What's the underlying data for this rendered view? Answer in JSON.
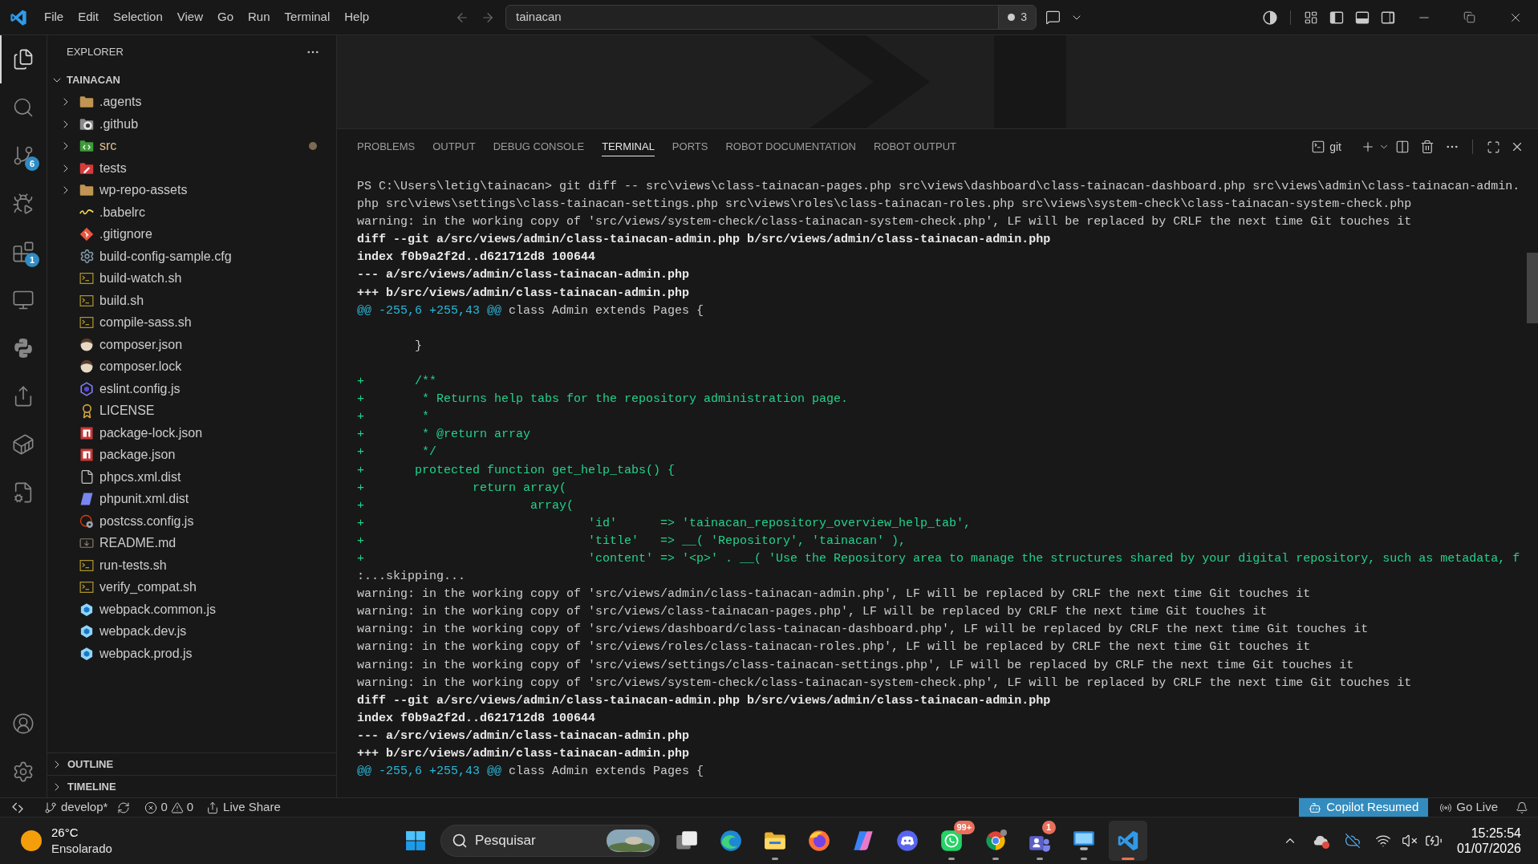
{
  "title_bar": {
    "menu": [
      "File",
      "Edit",
      "Selection",
      "View",
      "Go",
      "Run",
      "Terminal",
      "Help"
    ],
    "search": {
      "label": "tainacan",
      "badge": "3"
    },
    "layout_toggles": [
      {
        "kind": "primary-sidebar",
        "on": true
      },
      {
        "kind": "panel",
        "on": true
      },
      {
        "kind": "secondary-sidebar",
        "on": false
      }
    ]
  },
  "activity_bar": {
    "items": [
      {
        "kind": "explorer",
        "selected": true
      },
      {
        "kind": "search",
        "selected": false
      },
      {
        "kind": "source-control",
        "selected": false,
        "badge": "6"
      },
      {
        "kind": "run-debug",
        "selected": false
      },
      {
        "kind": "extensions",
        "selected": false,
        "badge": "1"
      },
      {
        "kind": "remote-explorer",
        "selected": false
      },
      {
        "kind": "python",
        "selected": false
      },
      {
        "kind": "live-share",
        "selected": false
      },
      {
        "kind": "containers",
        "selected": false
      },
      {
        "kind": "file-tools",
        "selected": false
      }
    ],
    "bottom": [
      {
        "kind": "accounts"
      },
      {
        "kind": "settings"
      }
    ]
  },
  "explorer": {
    "title": "EXPLORER",
    "root": {
      "label": "TAINACAN",
      "expanded": true,
      "children": [
        {
          "label": ".agents",
          "kind": "folder",
          "expanded": false,
          "modified": false
        },
        {
          "label": ".github",
          "kind": "github-folder",
          "expanded": false,
          "modified": false
        },
        {
          "label": "src",
          "kind": "source-folder",
          "expanded": false,
          "modified": true
        },
        {
          "label": "tests",
          "kind": "test-folder",
          "expanded": false,
          "modified": false
        },
        {
          "label": "wp-repo-assets",
          "kind": "folder",
          "expanded": false,
          "modified": false
        },
        {
          "label": ".babelrc",
          "kind": "babel",
          "modified": false
        },
        {
          "label": ".gitignore",
          "kind": "git",
          "modified": false
        },
        {
          "label": "build-config-sample.cfg",
          "kind": "config",
          "modified": false
        },
        {
          "label": "build-watch.sh",
          "kind": "shell",
          "modified": false
        },
        {
          "label": "build.sh",
          "kind": "shell",
          "modified": false
        },
        {
          "label": "compile-sass.sh",
          "kind": "shell",
          "modified": false
        },
        {
          "label": "composer.json",
          "kind": "composer",
          "modified": false
        },
        {
          "label": "composer.lock",
          "kind": "composer",
          "modified": false
        },
        {
          "label": "eslint.config.js",
          "kind": "eslint",
          "modified": false
        },
        {
          "label": "LICENSE",
          "kind": "license",
          "modified": false
        },
        {
          "label": "package-lock.json",
          "kind": "npm",
          "modified": false
        },
        {
          "label": "package.json",
          "kind": "npm",
          "modified": false
        },
        {
          "label": "phpcs.xml.dist",
          "kind": "text",
          "modified": false
        },
        {
          "label": "phpunit.xml.dist",
          "kind": "phpunit",
          "modified": false
        },
        {
          "label": "postcss.config.js",
          "kind": "postcss",
          "modified": false
        },
        {
          "label": "README.md",
          "kind": "markdown",
          "modified": false
        },
        {
          "label": "run-tests.sh",
          "kind": "shell",
          "modified": false
        },
        {
          "label": "verify_compat.sh",
          "kind": "shell",
          "modified": false
        },
        {
          "label": "webpack.common.js",
          "kind": "webpack",
          "modified": false
        },
        {
          "label": "webpack.dev.js",
          "kind": "webpack",
          "modified": false
        },
        {
          "label": "webpack.prod.js",
          "kind": "webpack",
          "modified": false
        }
      ]
    },
    "sections": [
      {
        "label": "OUTLINE",
        "expanded": false
      },
      {
        "label": "TIMELINE",
        "expanded": false
      }
    ]
  },
  "panel": {
    "tabs": [
      {
        "label": "PROBLEMS",
        "selected": false
      },
      {
        "label": "OUTPUT",
        "selected": false
      },
      {
        "label": "DEBUG CONSOLE",
        "selected": false
      },
      {
        "label": "TERMINAL",
        "selected": true
      },
      {
        "label": "PORTS",
        "selected": false
      },
      {
        "label": "ROBOT DOCUMENTATION",
        "selected": false
      },
      {
        "label": "ROBOT OUTPUT",
        "selected": false
      }
    ],
    "terminal": {
      "shell": "git",
      "lines": [
        {
          "kind": "prompt",
          "prompt": "PS C:\\Users\\letig\\tainacan>",
          "text": "git diff -- src\\views\\class-tainacan-pages.php src\\views\\dashboard\\class-tainacan-dashboard.php src\\views\\admin\\class-tainacan-admin."
        },
        {
          "kind": "plain",
          "text": "php src\\views\\settings\\class-tainacan-settings.php src\\views\\roles\\class-tainacan-roles.php src\\views\\system-check\\class-tainacan-system-check.php"
        },
        {
          "kind": "plain",
          "text": "warning: in the working copy of 'src/views/system-check/class-tainacan-system-check.php', LF will be replaced by CRLF the next time Git touches it"
        },
        {
          "kind": "bold",
          "text": "diff --git a/src/views/admin/class-tainacan-admin.php b/src/views/admin/class-tainacan-admin.php"
        },
        {
          "kind": "bold",
          "text": "index f0b9a2f2d..d621712d8 100644"
        },
        {
          "kind": "bold",
          "text": "--- a/src/views/admin/class-tainacan-admin.php"
        },
        {
          "kind": "bold",
          "text": "+++ b/src/views/admin/class-tainacan-admin.php"
        },
        {
          "kind": "hunk",
          "marker": "@@ -255,6 +255,43 @@",
          "text": "class Admin extends Pages {"
        },
        {
          "kind": "blank"
        },
        {
          "kind": "plain",
          "text": "        }"
        },
        {
          "kind": "blank"
        },
        {
          "kind": "added",
          "text": "+       /**"
        },
        {
          "kind": "added",
          "text": "+        * Returns help tabs for the repository administration page."
        },
        {
          "kind": "added",
          "text": "+        *"
        },
        {
          "kind": "added",
          "text": "+        * @return array"
        },
        {
          "kind": "added",
          "text": "+        */"
        },
        {
          "kind": "added",
          "text": "+       protected function get_help_tabs() {"
        },
        {
          "kind": "added",
          "text": "+               return array("
        },
        {
          "kind": "added",
          "text": "+                       array("
        },
        {
          "kind": "added",
          "text": "+                               'id'      => 'tainacan_repository_overview_help_tab',"
        },
        {
          "kind": "added",
          "text": "+                               'title'   => __( 'Repository', 'tainacan' ),"
        },
        {
          "kind": "added",
          "text": "+                               'content' => '<p>' . __( 'Use the Repository area to manage the structures shared by your digital repository, such as metadata, f"
        },
        {
          "kind": "plain",
          "text": ":...skipping..."
        },
        {
          "kind": "plain",
          "text": "warning: in the working copy of 'src/views/admin/class-tainacan-admin.php', LF will be replaced by CRLF the next time Git touches it"
        },
        {
          "kind": "plain",
          "text": "warning: in the working copy of 'src/views/class-tainacan-pages.php', LF will be replaced by CRLF the next time Git touches it"
        },
        {
          "kind": "plain",
          "text": "warning: in the working copy of 'src/views/dashboard/class-tainacan-dashboard.php', LF will be replaced by CRLF the next time Git touches it"
        },
        {
          "kind": "plain",
          "text": "warning: in the working copy of 'src/views/roles/class-tainacan-roles.php', LF will be replaced by CRLF the next time Git touches it"
        },
        {
          "kind": "plain",
          "text": "warning: in the working copy of 'src/views/settings/class-tainacan-settings.php', LF will be replaced by CRLF the next time Git touches it"
        },
        {
          "kind": "plain",
          "text": "warning: in the working copy of 'src/views/system-check/class-tainacan-system-check.php', LF will be replaced by CRLF the next time Git touches it"
        },
        {
          "kind": "bold",
          "text": "diff --git a/src/views/admin/class-tainacan-admin.php b/src/views/admin/class-tainacan-admin.php"
        },
        {
          "kind": "bold",
          "text": "index f0b9a2f2d..d621712d8 100644"
        },
        {
          "kind": "bold",
          "text": "--- a/src/views/admin/class-tainacan-admin.php"
        },
        {
          "kind": "bold",
          "text": "+++ b/src/views/admin/class-tainacan-admin.php"
        },
        {
          "kind": "hunk",
          "marker": "@@ -255,6 +255,43 @@",
          "text": "class Admin extends Pages {"
        }
      ]
    }
  },
  "status_bar": {
    "branch": "develop*",
    "errors": "0",
    "warnings": "0",
    "live_share": "Live Share",
    "copilot": "Copilot Resumed",
    "go_live": "Go Live"
  },
  "taskbar": {
    "weather": {
      "temperature": "26°C",
      "condition": "Ensolarado"
    },
    "search": {
      "placeholder": "Pesquisar"
    },
    "apps": [
      {
        "kind": "task-view",
        "running": false,
        "selected": false
      },
      {
        "kind": "edge",
        "running": false,
        "selected": false
      },
      {
        "kind": "file-explorer",
        "running": true,
        "selected": false
      },
      {
        "kind": "firefox",
        "running": false,
        "selected": false
      },
      {
        "kind": "copilot",
        "running": false,
        "selected": false
      },
      {
        "kind": "discord",
        "running": false,
        "selected": false
      },
      {
        "kind": "whatsapp",
        "running": true,
        "selected": false,
        "badge": "99+"
      },
      {
        "kind": "chrome",
        "running": true,
        "selected": false
      },
      {
        "kind": "teams",
        "running": true,
        "selected": false,
        "badge": "1"
      },
      {
        "kind": "remote-desktop",
        "running": true,
        "selected": false
      },
      {
        "kind": "vscode",
        "running": true,
        "selected": true
      }
    ],
    "clock": {
      "time": "15:25:54",
      "date": "01/07/2026"
    }
  }
}
